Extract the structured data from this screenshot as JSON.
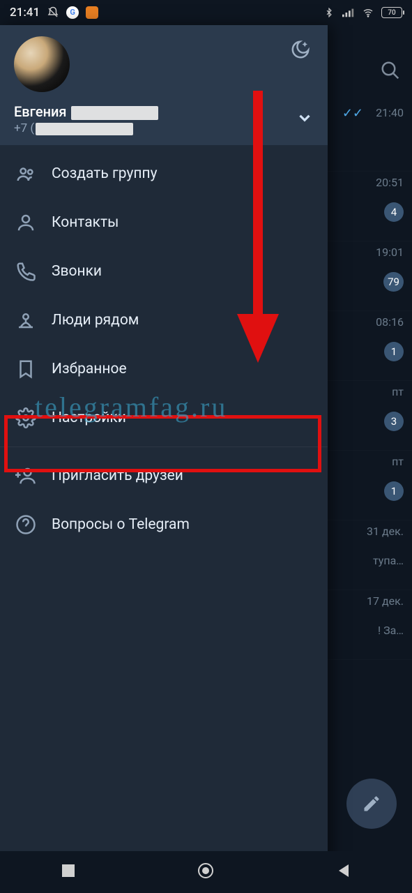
{
  "status": {
    "time": "21:41",
    "battery": "70"
  },
  "profile": {
    "name_visible": "Евгения",
    "phone_prefix": "+7 ("
  },
  "menu": {
    "create_group": "Создать группу",
    "contacts": "Контакты",
    "calls": "Звонки",
    "people_nearby": "Люди рядом",
    "saved": "Избранное",
    "settings": "Настройки",
    "invite": "Пригласить друзей",
    "faq": "Вопросы о Telegram"
  },
  "chats": {
    "row1": {
      "time": "21:40",
      "checks": "✓✓"
    },
    "row2": {
      "time": "20:51",
      "badge": "4"
    },
    "row3": {
      "time": "19:01",
      "badge": "79"
    },
    "row4": {
      "time": "08:16",
      "badge": "1"
    },
    "row5": {
      "time": "пт",
      "badge": "3"
    },
    "row6": {
      "time": "пт",
      "badge": "1"
    },
    "row7": {
      "time": "31 дек.",
      "snip": "тупа…"
    },
    "row8": {
      "time": "17 дек.",
      "snip": "! За…"
    }
  },
  "watermark": "telegramfag.ru"
}
